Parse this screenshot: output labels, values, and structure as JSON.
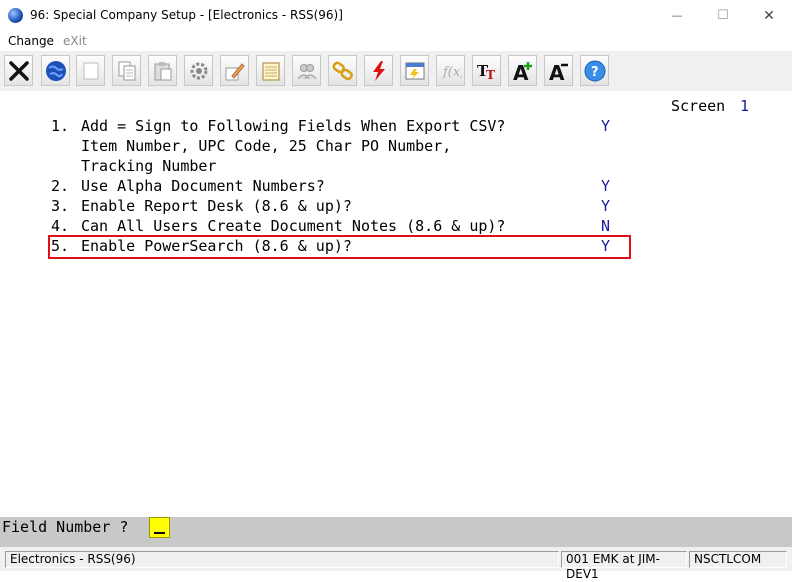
{
  "window": {
    "title": "96: Special Company Setup - [Electronics - RSS(96)]",
    "min_glyph": "—",
    "max_glyph": "☐",
    "close_glyph": "✕"
  },
  "menu": {
    "change": "Change",
    "exit": "eXit"
  },
  "toolbar": {
    "buttons": [
      "close-x-icon",
      "globe-icon",
      "blank-icon",
      "copy-icon",
      "paste-icon",
      "settings-gear-icon",
      "edit-pencil-icon",
      "notepad-icon",
      "users-icon",
      "link-chain-icon",
      "lightning-icon",
      "calendar-icon",
      "function-icon",
      "font-tt-icon",
      "font-increase-icon",
      "font-decrease-icon",
      "help-icon"
    ]
  },
  "screen_label": "Screen",
  "screen_number": "1",
  "options": [
    {
      "num": "1.",
      "text": "Add = Sign to Following Fields When Export CSV?",
      "value": "Y",
      "sub": [
        "Item Number, UPC Code, 25 Char PO Number,",
        "Tracking Number"
      ]
    },
    {
      "num": "2.",
      "text": "Use Alpha Document Numbers?",
      "value": "Y"
    },
    {
      "num": "3.",
      "text": "Enable Report Desk (8.6 & up)?",
      "value": "Y"
    },
    {
      "num": "4.",
      "text": "Can All Users Create Document Notes (8.6 & up)?",
      "value": "N"
    },
    {
      "num": "5.",
      "text": "Enable PowerSearch (8.6 & up)?",
      "value": "Y"
    }
  ],
  "field_prompt": "Field Number ?",
  "status": {
    "company": "Electronics - RSS(96)",
    "session": "001 EMK at JIM-DEV1",
    "server": "NSCTLCOM"
  }
}
